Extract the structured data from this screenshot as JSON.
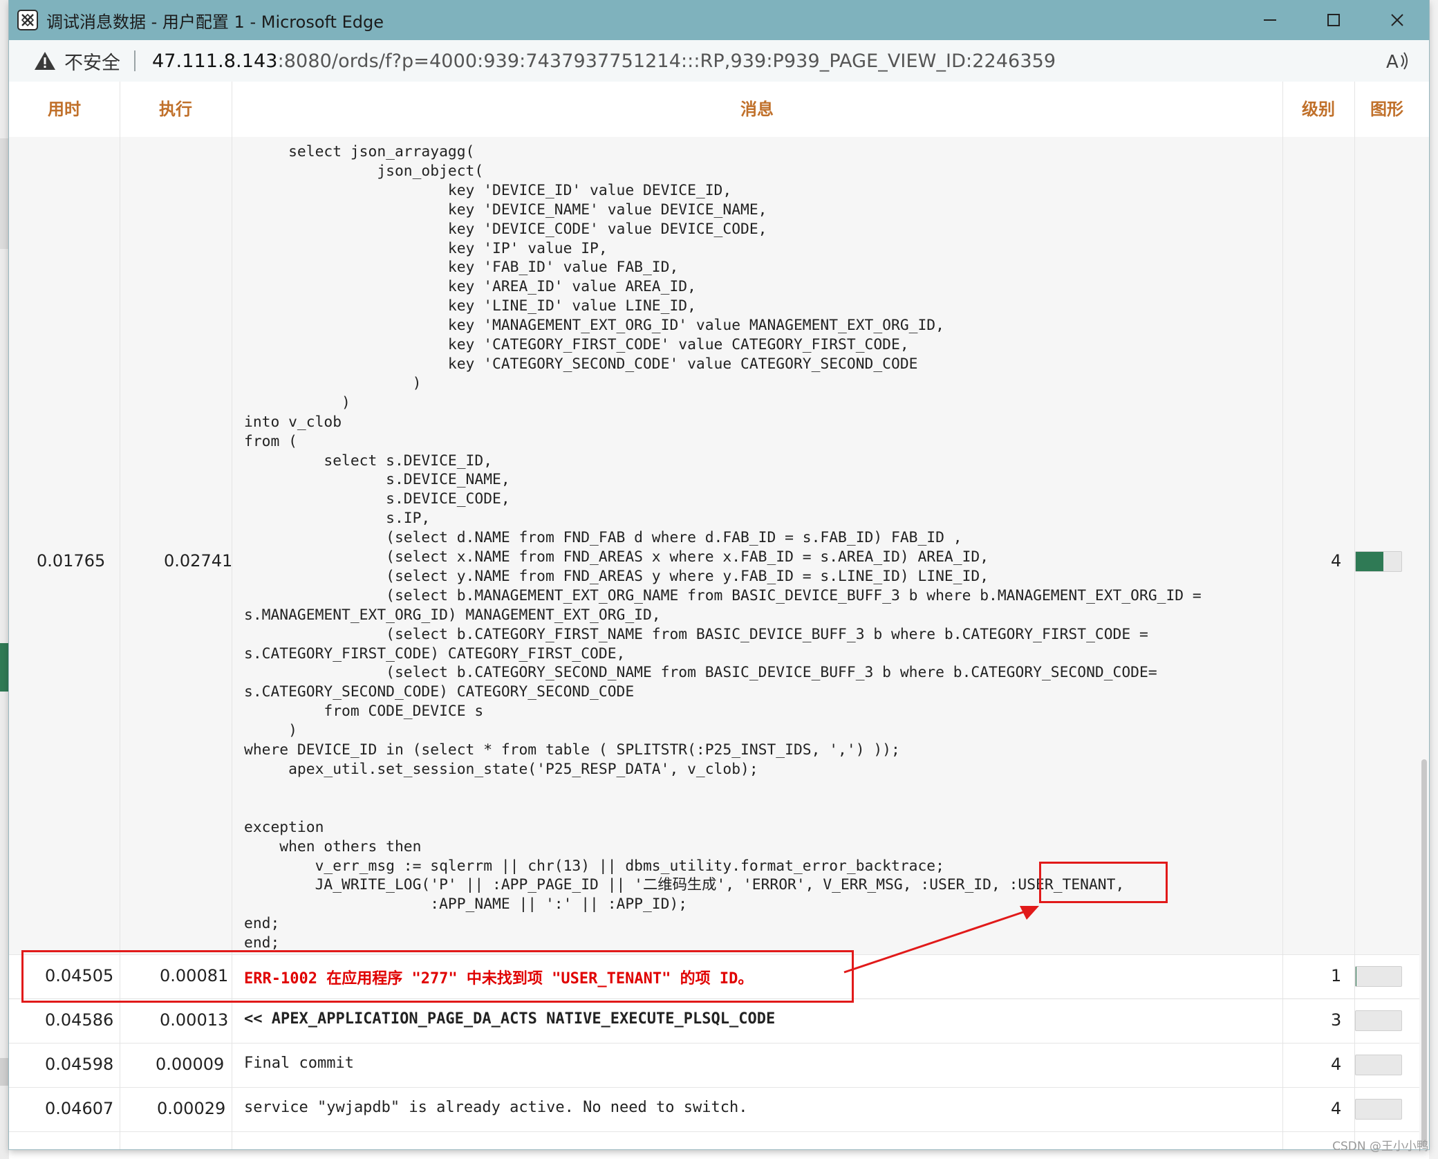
{
  "window": {
    "title": "调试消息数据 - 用户配置 1 - Microsoft Edge"
  },
  "address_bar": {
    "security_label": "不安全",
    "url_host": "47.111.8.143",
    "url_rest": ":8080/ords/f?p=4000:939:7437937751214:::RP,939:P939_PAGE_VIEW_ID:2246359"
  },
  "table": {
    "headers": {
      "elapsed": "用时",
      "execution": "执行",
      "message": "消息",
      "level": "级别",
      "graph": "图形"
    },
    "main_row": {
      "elapsed": "0.01765",
      "execution": "0.02741",
      "level": "4",
      "code": "     select json_arrayagg(\n               json_object(\n                       key 'DEVICE_ID' value DEVICE_ID,\n                       key 'DEVICE_NAME' value DEVICE_NAME,\n                       key 'DEVICE_CODE' value DEVICE_CODE,\n                       key 'IP' value IP,\n                       key 'FAB_ID' value FAB_ID,\n                       key 'AREA_ID' value AREA_ID,\n                       key 'LINE_ID' value LINE_ID,\n                       key 'MANAGEMENT_EXT_ORG_ID' value MANAGEMENT_EXT_ORG_ID,\n                       key 'CATEGORY_FIRST_CODE' value CATEGORY_FIRST_CODE,\n                       key 'CATEGORY_SECOND_CODE' value CATEGORY_SECOND_CODE\n                   )\n           )\ninto v_clob\nfrom (\n         select s.DEVICE_ID,\n                s.DEVICE_NAME,\n                s.DEVICE_CODE,\n                s.IP,\n                (select d.NAME from FND_FAB d where d.FAB_ID = s.FAB_ID) FAB_ID ,\n                (select x.NAME from FND_AREAS x where x.FAB_ID = s.AREA_ID) AREA_ID,\n                (select y.NAME from FND_AREAS y where y.FAB_ID = s.LINE_ID) LINE_ID,\n                (select b.MANAGEMENT_EXT_ORG_NAME from BASIC_DEVICE_BUFF_3 b where b.MANAGEMENT_EXT_ORG_ID =\ns.MANAGEMENT_EXT_ORG_ID) MANAGEMENT_EXT_ORG_ID,\n                (select b.CATEGORY_FIRST_NAME from BASIC_DEVICE_BUFF_3 b where b.CATEGORY_FIRST_CODE =\ns.CATEGORY_FIRST_CODE) CATEGORY_FIRST_CODE,\n                (select b.CATEGORY_SECOND_NAME from BASIC_DEVICE_BUFF_3 b where b.CATEGORY_SECOND_CODE=\ns.CATEGORY_SECOND_CODE) CATEGORY_SECOND_CODE\n         from CODE_DEVICE s\n     )\nwhere DEVICE_ID in (select * from table ( SPLITSTR(:P25_INST_IDS, ',') ));\n     apex_util.set_session_state('P25_RESP_DATA', v_clob);\n\n\nexception\n    when others then\n        v_err_msg := sqlerrm || chr(13) || dbms_utility.format_error_backtrace;\n        JA_WRITE_LOG('P' || :APP_PAGE_ID || '二维码生成', 'ERROR', V_ERR_MSG, :USER_ID, :USER_TENANT,\n                     :APP_NAME || ':' || :APP_ID);\nend;\nend;",
      "graph_fill": 0.6
    },
    "rows": [
      {
        "elapsed": "0.04505",
        "execution": "0.00081",
        "message": "ERR-1002 在应用程序 \"277\" 中未找到项 \"USER_TENANT\" 的项 ID。",
        "level": "1",
        "graph_fill": 0.02
      },
      {
        "elapsed": "0.04586",
        "execution": "0.00013",
        "message": "<< APEX_APPLICATION_PAGE_DA_ACTS NATIVE_EXECUTE_PLSQL_CODE",
        "level": "3",
        "graph_fill": 0
      },
      {
        "elapsed": "0.04598",
        "execution": "0.00009",
        "message": "Final commit",
        "level": "4",
        "graph_fill": 0
      },
      {
        "elapsed": "0.04607",
        "execution": "0.00029",
        "message": "service \"ywjapdb\" is already active. No need to switch.",
        "level": "4",
        "graph_fill": 0
      }
    ]
  },
  "watermark": "CSDN @王小小鸭"
}
